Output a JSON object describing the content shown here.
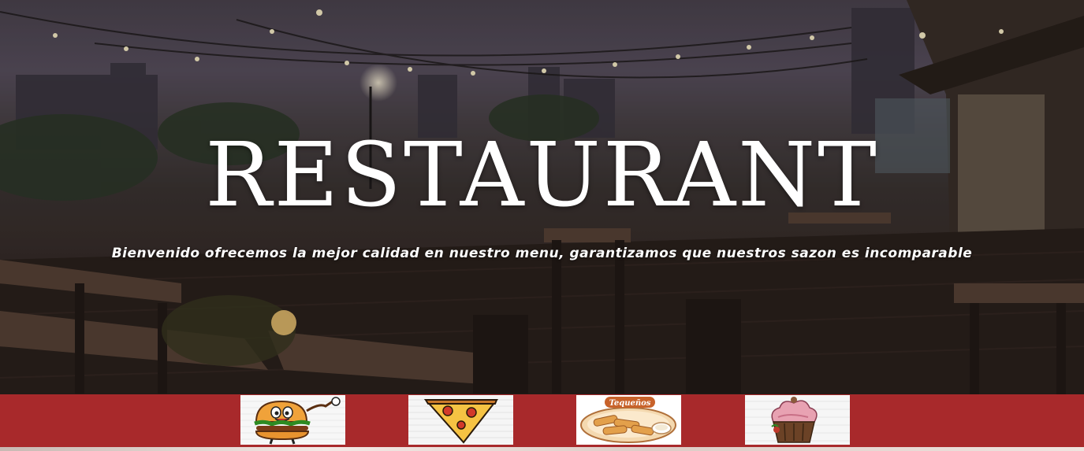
{
  "hero": {
    "title": "RESTAURANT",
    "subtitle": "Bienvenido ofrecemos la mejor calidad en nuestro menu, garantizamos que nuestros sazon es incomparable"
  },
  "menu": {
    "items": [
      {
        "name": "burger",
        "icon": "burger-icon"
      },
      {
        "name": "pizza",
        "icon": "pizza-icon"
      },
      {
        "name": "tequenos",
        "icon": "tequenos-icon",
        "label": "Tequeños"
      },
      {
        "name": "cupcake",
        "icon": "cupcake-icon"
      }
    ]
  },
  "colors": {
    "menu_bar": "#a8292b",
    "title": "#ffffff"
  }
}
